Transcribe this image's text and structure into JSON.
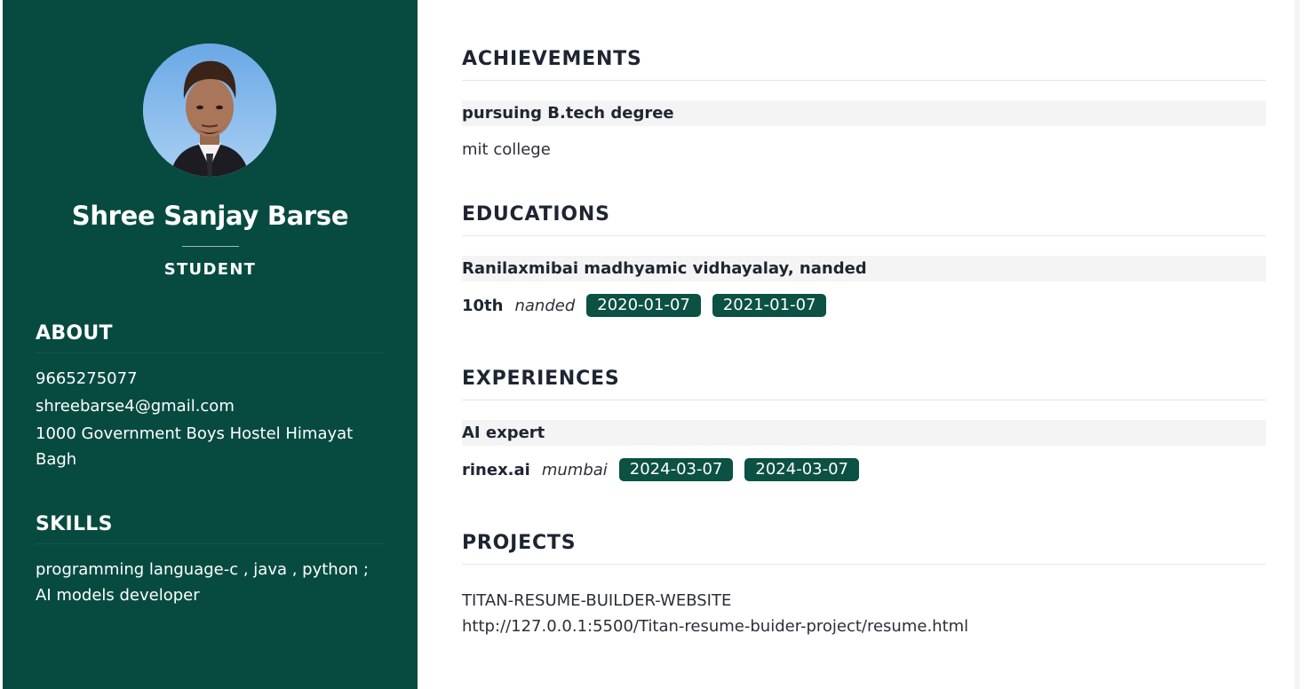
{
  "profile": {
    "name": "Shree Sanjay Barse",
    "role": "STUDENT"
  },
  "about": {
    "heading": "ABOUT",
    "phone": "9665275077",
    "email": "shreebarse4@gmail.com",
    "address": "1000 Government Boys Hostel Himayat Bagh"
  },
  "skills": {
    "heading": "SKILLS",
    "text": "programming language-c , java , python ; AI models developer"
  },
  "achievements": {
    "heading": "ACHIEVEMENTS",
    "title": "pursuing B.tech degree",
    "subtitle": "mit college"
  },
  "educations": {
    "heading": "EDUCATIONS",
    "title": "Ranilaxmibai madhyamic vidhayalay, nanded",
    "org": "10th",
    "location": "nanded",
    "start": "2020-01-07",
    "end": "2021-01-07"
  },
  "experiences": {
    "heading": "EXPERIENCES",
    "title": "AI expert",
    "org": "rinex.ai",
    "location": "mumbai",
    "start": "2024-03-07",
    "end": "2024-03-07"
  },
  "projects": {
    "heading": "PROJECTS",
    "name": "TITAN-RESUME-BUILDER-WEBSITE",
    "link": "http://127.0.0.1:5500/Titan-resume-buider-project/resume.html"
  },
  "colors": {
    "sidebar": "#074b40",
    "tag": "#0b5144",
    "heading": "#1e2532"
  }
}
